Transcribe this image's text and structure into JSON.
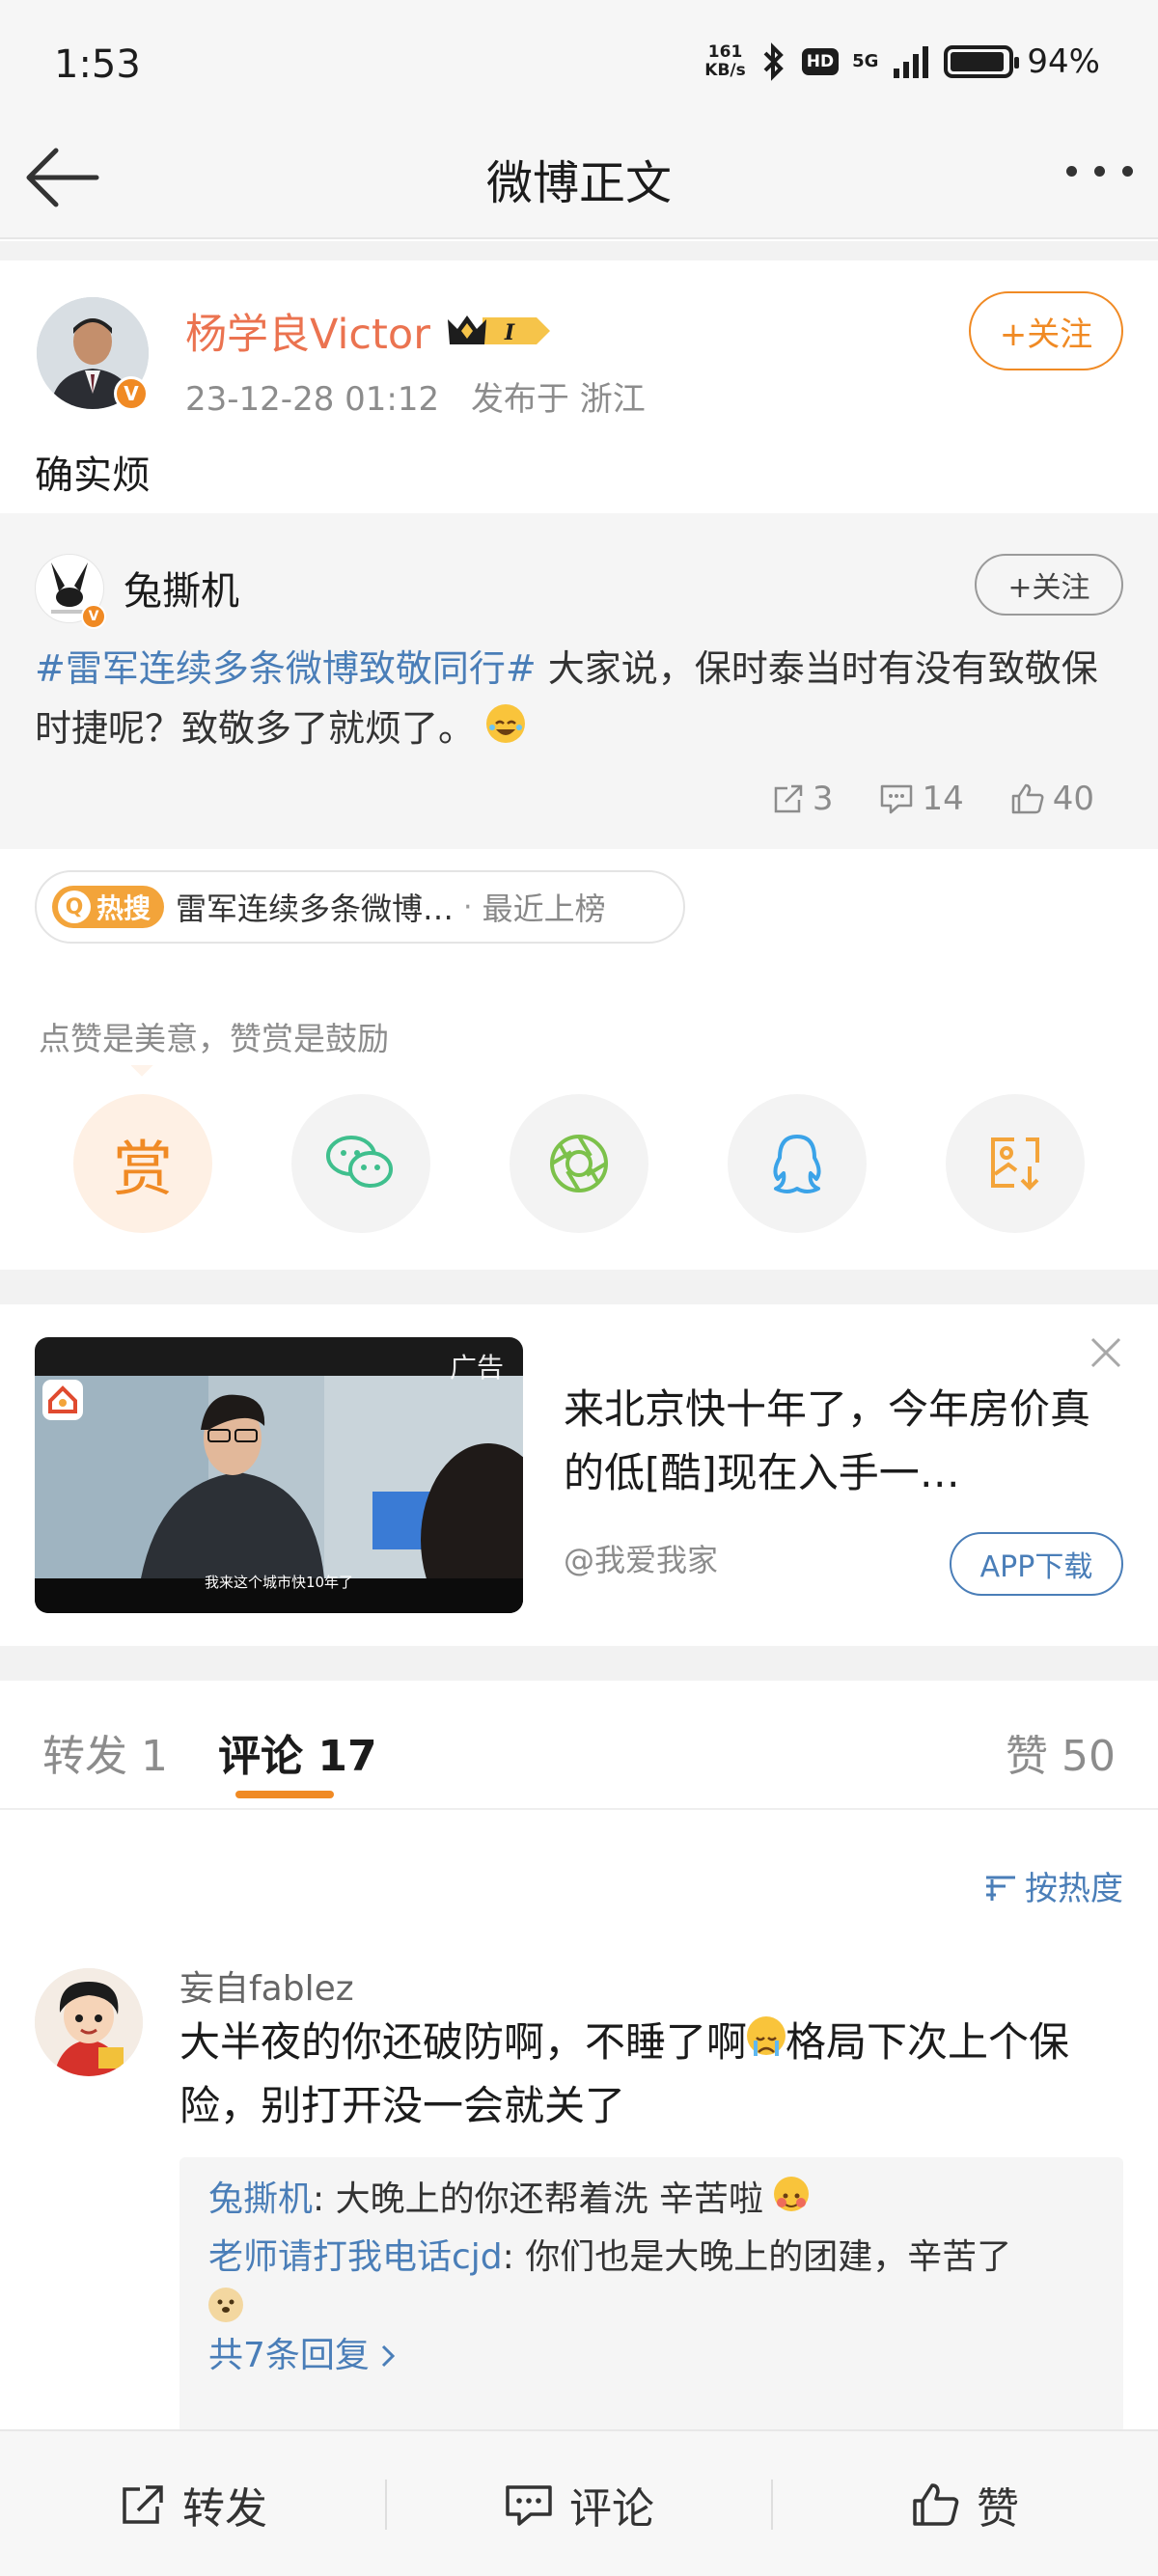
{
  "status_bar": {
    "time": "1:53",
    "net_speed_value": "161",
    "net_speed_unit": "KB/s",
    "hd": "HD",
    "network": "5G",
    "battery": "94%",
    "battery_level": 0.94
  },
  "nav": {
    "title": "微博正文",
    "back_icon": "back-arrow-icon",
    "more_icon": "more-dots-icon"
  },
  "post": {
    "author": "杨学良Victor",
    "member_badge": "I",
    "timestamp": "23-12-28 01:12",
    "location": "发布于 浙江",
    "follow_label": "+关注",
    "text": "确实烦"
  },
  "repost": {
    "author": "兔撕机",
    "follow_label": "+关注",
    "topic": "#雷军连续多条微博致敬同行#",
    "text": " 大家说，保时泰当时有没有致敬保时捷呢？致敬多了就烦了。",
    "stats": {
      "shares": "3",
      "comments": "14",
      "likes": "40"
    }
  },
  "hot_tag": {
    "badge": "热搜",
    "title": "雷军连续多条微博…",
    "separator": "·",
    "status": "最近上榜"
  },
  "reward": {
    "hint": "点赞是美意，赞赏是鼓励",
    "reward_label": "赏",
    "share_targets": [
      "wechat-icon",
      "moments-icon",
      "qq-icon",
      "save-image-icon"
    ]
  },
  "ad": {
    "label": "广告",
    "caption": "我来这个城市快10年了",
    "title": "来北京快十年了，今年房价真的低[酷]现在入手一…",
    "source": "@我爱我家",
    "button": "APP下载"
  },
  "tabs": {
    "reposts_label": "转发",
    "reposts_count": "1",
    "comments_label": "评论",
    "comments_count": "17",
    "likes_label": "赞",
    "likes_count": "50"
  },
  "sort": {
    "label": "按热度"
  },
  "comment": {
    "user": "妄自fablez",
    "text_before": "大半夜的你还破防啊，不睡了啊",
    "text_after": "格局下次上个保险，别打开没一会就关了",
    "replies": [
      {
        "user": "兔撕机",
        "text": ": 大晚上的你还帮着洗 辛苦啦 "
      },
      {
        "user": "老师请打我电话cjd",
        "text": ": 你们也是大晚上的团建，辛苦了"
      }
    ],
    "more_replies": "共7条回复"
  },
  "bottom_bar": {
    "repost": "转发",
    "comment": "评论",
    "like": "赞"
  },
  "colors": {
    "accent_orange": "#f08a24",
    "link_blue": "#4a7eb8",
    "name_orange": "#eb7350"
  }
}
